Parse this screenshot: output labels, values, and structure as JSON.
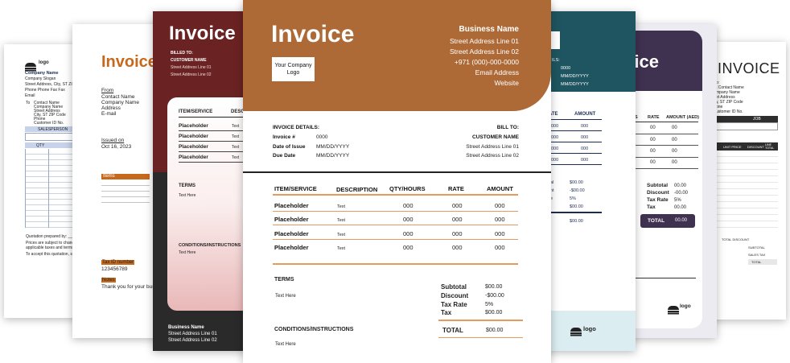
{
  "p1": {
    "logo": "logo",
    "company_name": "Company Name",
    "company_slogan": "Company Slogan",
    "address": "Street Address, City, ST ZIP Code",
    "phone": "Phone Phone Fax Fax",
    "email": "Email",
    "to_label": "To",
    "to_lines": [
      "Contact Name",
      "Company Name",
      "Street Address",
      "City, ST ZIP Code",
      "Phone",
      "Customer ID No."
    ],
    "salesperson": "SALESPERSON",
    "qty": "QTY",
    "footer1": "Quotation prepared by: ___________",
    "footer2": "Prices are subject to change based on",
    "footer3": "applicable taxes and terms.",
    "footer4": "To accept this quotation, sign here and return:"
  },
  "p2": {
    "title": "Invoice",
    "from_label": "From",
    "from_lines": [
      "Contact Name",
      "Company Name",
      "Address",
      "E-mail"
    ],
    "issued_label": "Issued on",
    "issued_date": "Oct 16, 2023",
    "items_label": "Items",
    "tax_label": "Tax ID number",
    "tax_value": "123456789",
    "notes_label": "Notes",
    "notes_text": "Thank you for your business"
  },
  "p3": {
    "title": "Invoice",
    "billed_to": "BILLED TO:",
    "customer_name": "CUSTOMER NAME",
    "street1": "Street Address Line 01",
    "street2": "Street Address Line 02",
    "col_item": "ITEM/SERVICE",
    "col_desc": "DESC",
    "rows": [
      {
        "item": "Placeholder",
        "desc": "Text"
      },
      {
        "item": "Placeholder",
        "desc": "Text"
      },
      {
        "item": "Placeholder",
        "desc": "Text"
      },
      {
        "item": "Placeholder",
        "desc": "Text"
      }
    ],
    "terms": "TERMS",
    "terms_text": "Text Here",
    "conditions": "CONDITIONS/INSTRUCTIONS",
    "conditions_text": "Text Here",
    "footer_name": "Business Name",
    "footer_street1": "Street Address Line 01",
    "footer_street2": "Street Address Line 02"
  },
  "p4": {
    "title": "Invoice",
    "logo_line1": "Your Company",
    "logo_line2": "Logo",
    "business_name": "Business Name",
    "street1": "Street Address Line 01",
    "street2": "Street Address Line 02",
    "phone": "+971 (000)-000-0000",
    "email": "Email Address",
    "website": "Website",
    "details_label": "INVOICE DETAILS:",
    "invoice_no_label": "Invoice #",
    "invoice_no": "0000",
    "issue_label": "Date of Issue",
    "issue_value": "MM/DD/YYYY",
    "due_label": "Due Date",
    "due_value": "MM/DD/YYYY",
    "bill_to": "BILL TO:",
    "customer_name": "CUSTOMER NAME",
    "cust_street1": "Street Address Line 01",
    "cust_street2": "Street Address Line 02",
    "columns": [
      "ITEM/SERVICE",
      "DESCRIPTION",
      "QTY/HOURS",
      "RATE",
      "AMOUNT"
    ],
    "rows": [
      {
        "item": "Placeholder",
        "desc": "Text",
        "qty": "000",
        "rate": "000",
        "amount": "000"
      },
      {
        "item": "Placeholder",
        "desc": "Text",
        "qty": "000",
        "rate": "000",
        "amount": "000"
      },
      {
        "item": "Placeholder",
        "desc": "Text",
        "qty": "000",
        "rate": "000",
        "amount": "000"
      },
      {
        "item": "Placeholder",
        "desc": "Text",
        "qty": "000",
        "rate": "000",
        "amount": "000"
      }
    ],
    "terms": "TERMS",
    "terms_text": "Text Here",
    "conditions": "CONDITIONS/INSTRUCTIONS",
    "conditions_text": "Text Here",
    "subtotal_label": "Subtotal",
    "subtotal": "$00.00",
    "discount_label": "Discount",
    "discount": "-$00.00",
    "taxrate_label": "Tax Rate",
    "taxrate": "5%",
    "tax_label": "Tax",
    "tax": "$00.00",
    "total_label": "TOTAL",
    "total": "$00.00"
  },
  "p5": {
    "details_label": "ILS:",
    "details_val": "0000",
    "date1": "MM/DD/YYYY",
    "date2": "MM/DD/YYYY",
    "rate_col": "ATE",
    "amount_col": "AMOUNT",
    "rows": [
      {
        "rate": "000",
        "amount": "000"
      },
      {
        "rate": "000",
        "amount": "000"
      },
      {
        "rate": "000",
        "amount": "000"
      },
      {
        "rate": "000",
        "amount": "000"
      }
    ],
    "summary_labels": [
      "al",
      "nt",
      "e",
      ""
    ],
    "summary_values": [
      "$00.00",
      "-$00.00",
      "5%",
      "$00.00"
    ],
    "grand_total": "$00.00",
    "logo": "logo"
  },
  "p6": {
    "title": "oice",
    "col_s": "S",
    "col_rate": "RATE",
    "col_amount": "AMOUNT (AED)",
    "rows": [
      {
        "rate": "00",
        "amount": "00"
      },
      {
        "rate": "00",
        "amount": "00"
      },
      {
        "rate": "00",
        "amount": "00"
      },
      {
        "rate": "00",
        "amount": "00"
      }
    ],
    "subtotal_label": "Subtotal",
    "subtotal": "00.00",
    "discount_label": "Discount",
    "discount": "-00.00",
    "taxrate_label": "Tax Rate",
    "taxrate": "5%",
    "tax_label": "Tax",
    "tax": "00.00",
    "total_label": "TOTAL",
    "total": "00.00",
    "logo": "logo"
  },
  "p7": {
    "title": "INVOICE",
    "lines": [
      "o:",
      "t Contact Name",
      "mpany Name",
      "et Address",
      "y, ST ZIP Code",
      "one",
      "ustomer ID No."
    ],
    "job_col": "JOB",
    "unit_price": "UNIT PRICE",
    "discount": "DISCOUNT",
    "line_total": "LINE TOTAL",
    "total_discount": "TOTAL DISCOUNT",
    "subtotal": "SUBTOTAL",
    "sales_tax": "SALES TAX",
    "total": "TOTAL"
  },
  "colors": {
    "copper": "#ad6a37",
    "orange_rule": "#e59a5e",
    "maroon": "#6b2222",
    "teal": "#1e5560",
    "purple": "#3f3150",
    "navy": "#1d2c55",
    "orange_title": "#c7691c"
  }
}
